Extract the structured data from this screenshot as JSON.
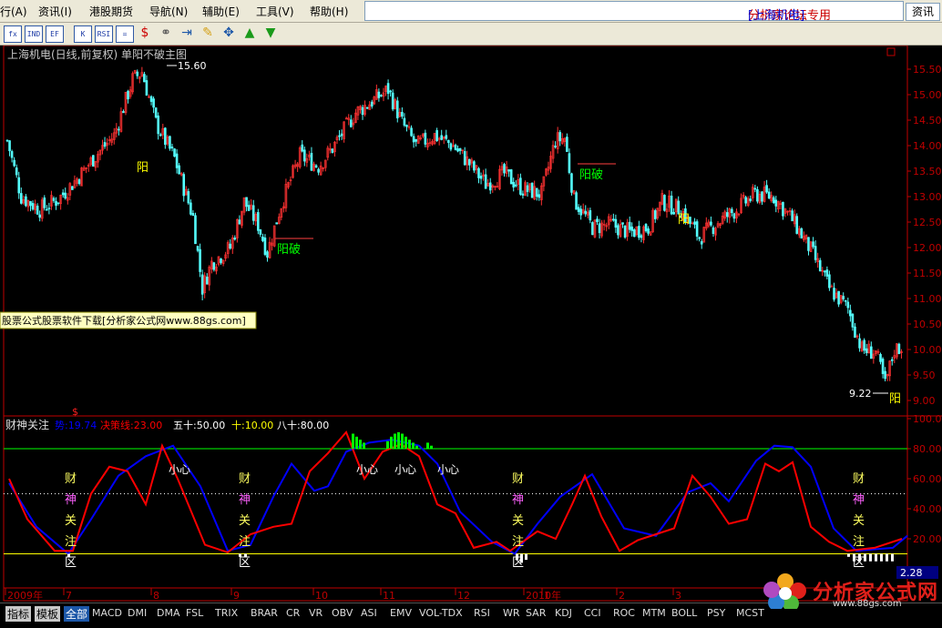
{
  "menu": {
    "items": [
      "行(A)",
      "资讯(I)",
      "港股期货",
      "导航(N)",
      "辅助(E)",
      "工具(V)",
      "帮助(H)"
    ],
    "title_prefix": "分析家论坛专用 ",
    "title_stock": "[上海机电]",
    "info_button": "资讯"
  },
  "toolbar": {
    "tools": [
      {
        "label": "fx",
        "icon": "formula-icon"
      },
      {
        "label": "IND",
        "icon": "indicator-icon"
      },
      {
        "label": "EF",
        "icon": "export-icon"
      },
      {
        "label": "K",
        "icon": "chart-icon"
      },
      {
        "label": "RSI",
        "icon": "rsi-icon"
      },
      {
        "label": "=",
        "icon": "list-icon"
      },
      {
        "label": "$",
        "icon": "dollar-icon"
      },
      {
        "label": "⚭",
        "icon": "link-icon"
      },
      {
        "label": "⇥",
        "icon": "goto-icon"
      },
      {
        "label": "✎",
        "icon": "pencil-icon"
      },
      {
        "label": "✥",
        "icon": "move-icon"
      },
      {
        "label": "▲",
        "icon": "arrow-up-icon"
      },
      {
        "label": "▼",
        "icon": "arrow-down-icon"
      }
    ]
  },
  "main_chart": {
    "header": "上海机电(日线,前复权) 单阳不破主图",
    "high_label": "15.60",
    "low_label": "9.22",
    "yang": "阳",
    "broken_marker": "阳破",
    "ad_banner": "股票公式股票软件下载[分析家公式网www.88gs.com]",
    "ticks": [
      "15.50",
      "15.00",
      "14.50",
      "14.00",
      "13.50",
      "13.00",
      "12.50",
      "12.00",
      "11.50",
      "11.00",
      "10.50",
      "10.00",
      "9.50",
      "9.00"
    ],
    "colors": {
      "up": "#ff3232",
      "down": "#54ffff",
      "axis": "#c00000",
      "yang": "#ffff00",
      "broken": "#00ff00"
    }
  },
  "indicator": {
    "name": "财神关注",
    "trend_label": "势:19.74",
    "decision_label": "决策线:23.00",
    "fifty": "五十:50.00",
    "ten": "十:10.00",
    "eighty": "八十:80.00",
    "ticks": [
      "100.0",
      "80.00",
      "60.00",
      "40.00",
      "20.00"
    ],
    "current_value": "2.28",
    "marker": "$",
    "careful": "小心",
    "attention_chars": [
      "财",
      "神",
      "关",
      "注",
      "区"
    ],
    "colors": {
      "trend": "#0000ff",
      "decision": "#ff0000",
      "fifty": "#ffffff",
      "ten": "#ffff00",
      "eighty": "#00ff00"
    }
  },
  "time_axis": {
    "labels": [
      "2009年",
      "7",
      "8",
      "9",
      "10",
      "11",
      "12",
      "2010年",
      "1",
      "2",
      "3"
    ]
  },
  "tabs": {
    "left": [
      "指标",
      "模板",
      "全部"
    ],
    "indicators": [
      "MACD",
      "DMI",
      "DMA",
      "FSL",
      "TRIX",
      "BRAR",
      "CR",
      "VR",
      "OBV",
      "ASI",
      "EMV",
      "VOL-TDX",
      "RSI",
      "WR",
      "SAR",
      "KDJ",
      "CCI",
      "ROC",
      "MTM",
      "BOLL",
      "PSY",
      "MCST"
    ]
  },
  "logo": {
    "text": "分析家公式网",
    "url": "www.88gs.com"
  }
}
